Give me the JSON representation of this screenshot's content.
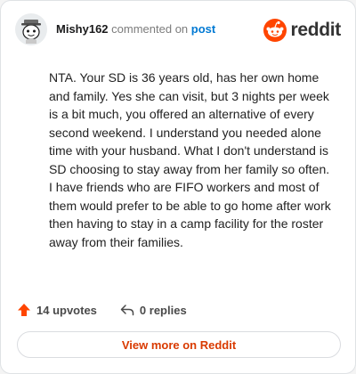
{
  "header": {
    "username": "Mishy162",
    "action": "commented on",
    "target": "post",
    "brand": "reddit"
  },
  "comment": {
    "text": "NTA. Your SD is 36 years old, has her own home and family. Yes she can visit, but 3 nights per week is a bit much, you offered an alternative of every second weekend. I understand you needed alone time with your husband. What I don't understand is SD choosing to stay away from her family so often. I have friends who are FIFO workers and most of them would prefer to be able to go home after work then having to stay in a camp facility for the roster away from their families."
  },
  "actions": {
    "upvotes": "14 upvotes",
    "replies": "0 replies"
  },
  "footer": {
    "view_more": "View more on Reddit"
  },
  "colors": {
    "brand": "#ff4500",
    "link": "#0079d3",
    "view_more": "#d93a00"
  },
  "icons": [
    "snoo-avatar-icon",
    "reddit-logo-icon",
    "upvote-arrow-icon",
    "reply-arrow-icon"
  ]
}
